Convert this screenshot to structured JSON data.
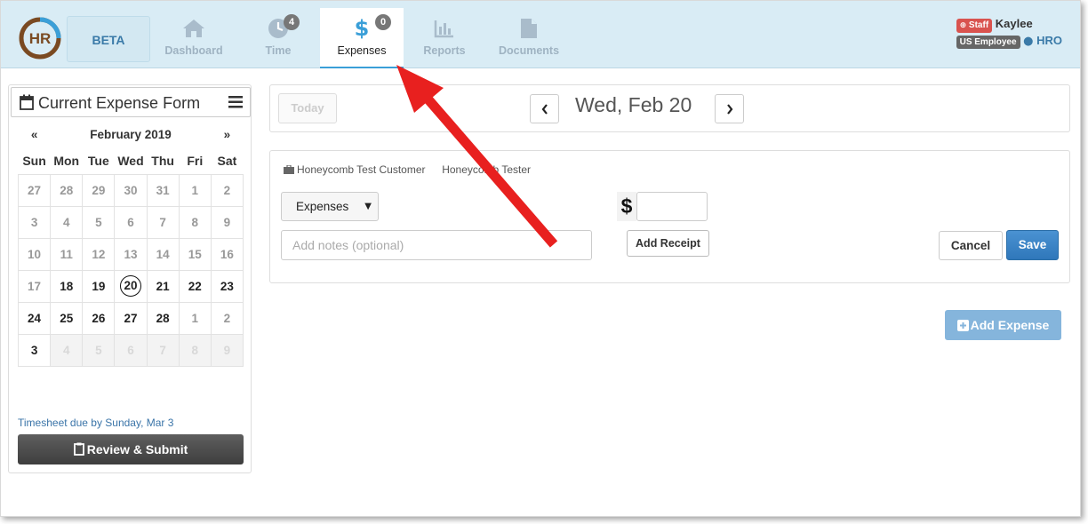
{
  "header": {
    "beta_label": "BETA",
    "nav": [
      {
        "label": "Dashboard",
        "icon": "home-icon"
      },
      {
        "label": "Time",
        "icon": "clock-icon",
        "badge": "4"
      },
      {
        "label": "Expenses",
        "icon": "dollar-icon",
        "badge": "0",
        "active": true
      },
      {
        "label": "Reports",
        "icon": "bar-chart-icon"
      },
      {
        "label": "Documents",
        "icon": "document-icon"
      }
    ],
    "user": {
      "staff_tag": "Staff",
      "name": "Kaylee",
      "employee_tag": "US Employee",
      "org": "HRO"
    }
  },
  "sidebar": {
    "title": "Current Expense Form",
    "calendar": {
      "prev": "«",
      "month": "February 2019",
      "next": "»",
      "weekdays": [
        "Sun",
        "Mon",
        "Tue",
        "Wed",
        "Thu",
        "Fri",
        "Sat"
      ],
      "weeks": [
        [
          "27",
          "28",
          "29",
          "30",
          "31",
          "1",
          "2"
        ],
        [
          "3",
          "4",
          "5",
          "6",
          "7",
          "8",
          "9"
        ],
        [
          "10",
          "11",
          "12",
          "13",
          "14",
          "15",
          "16"
        ],
        [
          "17",
          "18",
          "19",
          "20",
          "21",
          "22",
          "23"
        ],
        [
          "24",
          "25",
          "26",
          "27",
          "28",
          "1",
          "2"
        ],
        [
          "3",
          "4",
          "5",
          "6",
          "7",
          "8",
          "9"
        ]
      ],
      "selected": "20"
    },
    "due_text": "Timesheet due by Sunday, Mar 3",
    "review_label": "Review & Submit"
  },
  "datebar": {
    "today_label": "Today",
    "date": "Wed, Feb 20"
  },
  "expense_form": {
    "customer": "Honeycomb Test Customer",
    "project": "Honeycomb Tester",
    "category": "Expenses",
    "notes_placeholder": "Add notes (optional)",
    "currency": "$",
    "amount": "",
    "add_receipt_label": "Add Receipt",
    "cancel_label": "Cancel",
    "save_label": "Save"
  },
  "add_expense_label": "Add Expense",
  "colors": {
    "topbar": "#d9ecf5",
    "accent": "#3a9fd8",
    "save": "#337ab7",
    "annotation_arrow": "#e8201f"
  }
}
